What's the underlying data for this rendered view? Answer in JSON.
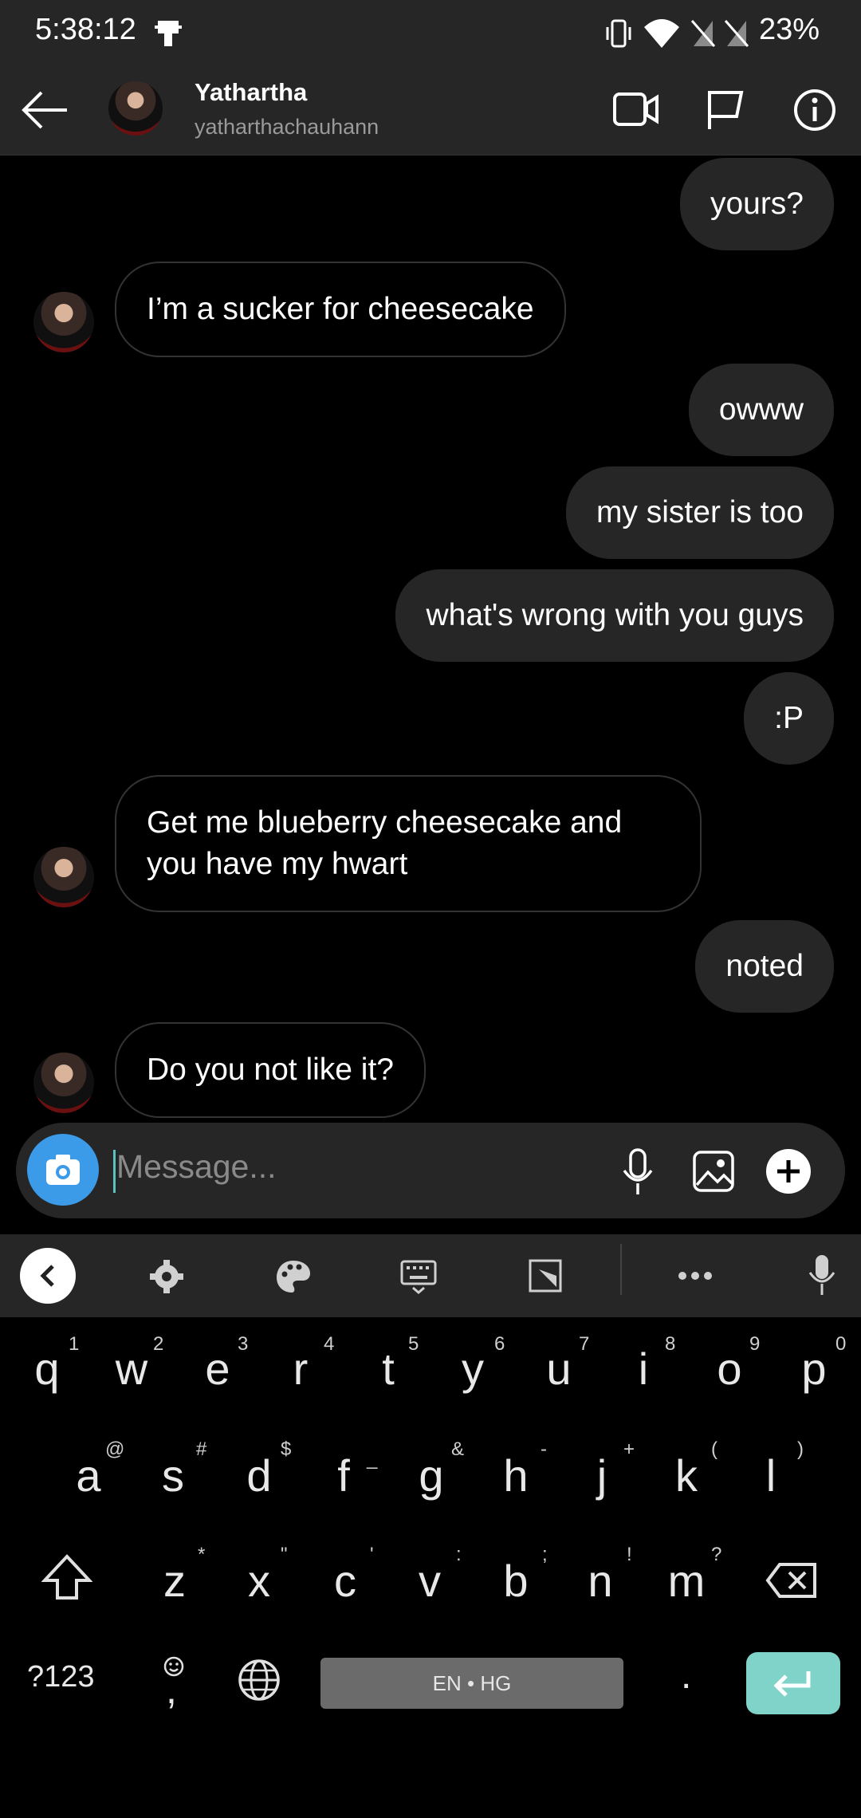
{
  "status_bar": {
    "time": "5:38:12",
    "battery": "23%",
    "icons": [
      "notification-icon",
      "vibrate-icon",
      "wifi-icon",
      "no-sim-icon",
      "no-sim-icon"
    ]
  },
  "header": {
    "back_icon": "back-arrow-icon",
    "name": "Yathartha",
    "username": "yatharthachauhann",
    "actions": [
      "video-call-icon",
      "flag-icon",
      "info-icon"
    ]
  },
  "messages": [
    {
      "side": "out",
      "text": "yours?"
    },
    {
      "side": "in",
      "text": "I’m a sucker for cheesecake"
    },
    {
      "side": "out",
      "text": "owww"
    },
    {
      "side": "out",
      "text": "my sister is too"
    },
    {
      "side": "out",
      "text": "what's wrong with you guys"
    },
    {
      "side": "out",
      "text": ":P"
    },
    {
      "side": "in",
      "text": "Get me blueberry cheesecake and you have my hwart"
    },
    {
      "side": "out",
      "text": "noted"
    },
    {
      "side": "in",
      "text": "Do you not like it?"
    }
  ],
  "composer": {
    "placeholder": "Message...",
    "icons": [
      "camera-icon",
      "microphone-icon",
      "gallery-icon",
      "plus-icon"
    ]
  },
  "keyboard": {
    "toolbar_icons": [
      "chevron-left-icon",
      "settings-icon",
      "palette-icon",
      "keyboard-icon",
      "resize-icon",
      "more-icon",
      "mic-icon"
    ],
    "row1": [
      "q",
      "w",
      "e",
      "r",
      "t",
      "y",
      "u",
      "i",
      "o",
      "p"
    ],
    "row1_hints": [
      "1",
      "2",
      "3",
      "4",
      "5",
      "6",
      "7",
      "8",
      "9",
      "0"
    ],
    "row2": [
      "a",
      "s",
      "d",
      "f",
      "g",
      "h",
      "j",
      "k",
      "l"
    ],
    "row2_hints": [
      "@",
      "#",
      "$",
      "_",
      "&",
      "-",
      "+",
      "(",
      ")"
    ],
    "row3": [
      "z",
      "x",
      "c",
      "v",
      "b",
      "n",
      "m"
    ],
    "row3_hints": [
      "*",
      "\"",
      "'",
      ":",
      ";",
      "!",
      "?"
    ],
    "symbols_key": "?123",
    "comma_key": ",",
    "space_label": "EN • HG",
    "period_key": "."
  }
}
